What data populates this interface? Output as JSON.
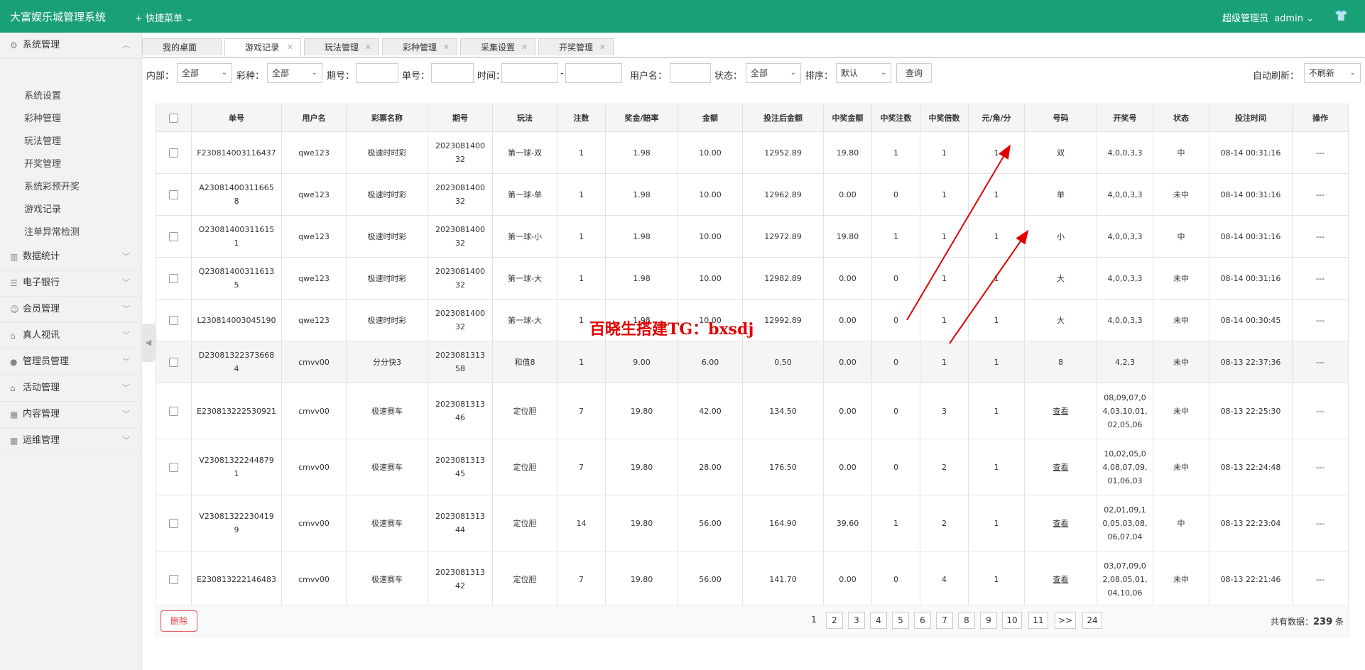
{
  "app": {
    "title": "大富娱乐城管理系统",
    "quick_menu": "快捷菜单",
    "user_role": "超级管理员",
    "user_name": "admin"
  },
  "sidebar": {
    "system": "系统管理",
    "subitems": [
      "系统设置",
      "彩种管理",
      "玩法管理",
      "开奖管理",
      "系统彩预开奖",
      "游戏记录",
      "注单异常检测"
    ],
    "groups": [
      "数据统计",
      "电子银行",
      "会员管理",
      "真人视讯",
      "管理员管理",
      "活动管理",
      "内容管理",
      "运维管理"
    ]
  },
  "tabs": [
    "我的桌面",
    "游戏记录",
    "玩法管理",
    "彩种管理",
    "采集设置",
    "开奖管理"
  ],
  "filters": {
    "inner_label": "内部：",
    "inner_value": "全部",
    "lottery_label": "彩种：",
    "lottery_value": "全部",
    "period_label": "期号：",
    "order_label": "单号：",
    "time_label": "时间：",
    "time_sep": "-",
    "username_label": "用户名：",
    "status_label": "状态：",
    "status_value": "全部",
    "sort_label": "排序：",
    "sort_value": "默认",
    "query_button": "查询",
    "refresh_label": "自动刷新：",
    "refresh_value": "不刷新"
  },
  "table": {
    "headers": [
      "单号",
      "用户名",
      "彩票名称",
      "期号",
      "玩法",
      "注数",
      "奖金/赔率",
      "金额",
      "投注后金额",
      "中奖金额",
      "中奖注数",
      "中奖倍数",
      "元/角/分",
      "号码",
      "开奖号",
      "状态",
      "投注时间",
      "操作"
    ],
    "rows": [
      {
        "order": "F230814003116437",
        "user": "qwe123",
        "lottery": "极速时时彩",
        "period": "202308140032",
        "play": "第一球-双",
        "bets": "1",
        "odds": "1.98",
        "amount": "10.00",
        "after": "12952.89",
        "win_amount": "19.80",
        "win_bets": "1",
        "multiple": "1",
        "unit": "1",
        "number": "双",
        "draw": "4,0,0,3,3",
        "status": "中",
        "win": true,
        "time": "08-14 00:31:16",
        "op": "---"
      },
      {
        "order": "A230814003116658",
        "user": "qwe123",
        "lottery": "极速时时彩",
        "period": "202308140032",
        "play": "第一球-单",
        "bets": "1",
        "odds": "1.98",
        "amount": "10.00",
        "after": "12962.89",
        "win_amount": "0.00",
        "win_bets": "0",
        "multiple": "1",
        "unit": "1",
        "number": "单",
        "draw": "4,0,0,3,3",
        "status": "未中",
        "win": false,
        "time": "08-14 00:31:16",
        "op": "---"
      },
      {
        "order": "O230814003116151",
        "user": "qwe123",
        "lottery": "极速时时彩",
        "period": "202308140032",
        "play": "第一球-小",
        "bets": "1",
        "odds": "1.98",
        "amount": "10.00",
        "after": "12972.89",
        "win_amount": "19.80",
        "win_bets": "1",
        "multiple": "1",
        "unit": "1",
        "number": "小",
        "draw": "4,0,0,3,3",
        "status": "中",
        "win": true,
        "time": "08-14 00:31:16",
        "op": "---"
      },
      {
        "order": "Q230814003116135",
        "user": "qwe123",
        "lottery": "极速时时彩",
        "period": "202308140032",
        "play": "第一球-大",
        "bets": "1",
        "odds": "1.98",
        "amount": "10.00",
        "after": "12982.89",
        "win_amount": "0.00",
        "win_bets": "0",
        "multiple": "1",
        "unit": "1",
        "number": "大",
        "draw": "4,0,0,3,3",
        "status": "未中",
        "win": false,
        "time": "08-14 00:31:16",
        "op": "---"
      },
      {
        "order": "L230814003045190",
        "user": "qwe123",
        "lottery": "极速时时彩",
        "period": "202308140032",
        "play": "第一球-大",
        "bets": "1",
        "odds": "1.98",
        "amount": "10.00",
        "after": "12992.89",
        "win_amount": "0.00",
        "win_bets": "0",
        "multiple": "1",
        "unit": "1",
        "number": "大",
        "draw": "4,0,0,3,3",
        "status": "未中",
        "win": false,
        "time": "08-14 00:30:45",
        "op": "---"
      },
      {
        "order": "D230813223736684",
        "user": "cmvv00",
        "lottery": "分分快3",
        "period": "202308131358",
        "play": "和值8",
        "bets": "1",
        "odds": "9.00",
        "amount": "6.00",
        "after": "0.50",
        "win_amount": "0.00",
        "win_bets": "0",
        "multiple": "1",
        "unit": "1",
        "number": "8",
        "draw": "4,2,3",
        "status": "未中",
        "win": false,
        "time": "08-13 22:37:36",
        "op": "---"
      },
      {
        "order": "E230813222530921",
        "user": "cmvv00",
        "lottery": "极速赛车",
        "period": "202308131346",
        "play": "定位胆",
        "bets": "7",
        "odds": "19.80",
        "amount": "42.00",
        "after": "134.50",
        "win_amount": "0.00",
        "win_bets": "0",
        "multiple": "3",
        "unit": "1",
        "number": "查看",
        "draw": "08,09,07,04,03,10,01,02,05,06",
        "status": "未中",
        "win": false,
        "time": "08-13 22:25:30",
        "op": "---"
      },
      {
        "order": "V230813222448791",
        "user": "cmvv00",
        "lottery": "极速赛车",
        "period": "202308131345",
        "play": "定位胆",
        "bets": "7",
        "odds": "19.80",
        "amount": "28.00",
        "after": "176.50",
        "win_amount": "0.00",
        "win_bets": "0",
        "multiple": "2",
        "unit": "1",
        "number": "查看",
        "draw": "10,02,05,04,08,07,09,01,06,03",
        "status": "未中",
        "win": false,
        "time": "08-13 22:24:48",
        "op": "---"
      },
      {
        "order": "V230813222304199",
        "user": "cmvv00",
        "lottery": "极速赛车",
        "period": "202308131344",
        "play": "定位胆",
        "bets": "14",
        "odds": "19.80",
        "amount": "56.00",
        "after": "164.90",
        "win_amount": "39.60",
        "win_bets": "1",
        "multiple": "2",
        "unit": "1",
        "number": "查看",
        "draw": "02,01,09,10,05,03,08,06,07,04",
        "status": "中",
        "win": true,
        "time": "08-13 22:23:04",
        "op": "---"
      },
      {
        "order": "E230813222146483",
        "user": "cmvv00",
        "lottery": "极速赛车",
        "period": "202308131342",
        "play": "定位胆",
        "bets": "7",
        "odds": "19.80",
        "amount": "56.00",
        "after": "141.70",
        "win_amount": "0.00",
        "win_bets": "0",
        "multiple": "4",
        "unit": "1",
        "number": "查看",
        "draw": "03,07,09,02,08,05,01,04,10,06",
        "status": "未中",
        "win": false,
        "time": "08-13 22:21:46",
        "op": "---"
      }
    ]
  },
  "footer": {
    "delete_button": "删除",
    "pages": [
      "1",
      "2",
      "3",
      "4",
      "5",
      "6",
      "7",
      "8",
      "9",
      "10",
      "11",
      ">>",
      "24"
    ],
    "total_label": "共有数据：",
    "total_count": "239",
    "total_unit": "条"
  },
  "overlay_text": "百晓生搭建TG：bxsdj",
  "colors": {
    "primary": "#1aa077",
    "win": "#1a9e3a",
    "lose": "#e02020",
    "annotation": "#e00000"
  }
}
